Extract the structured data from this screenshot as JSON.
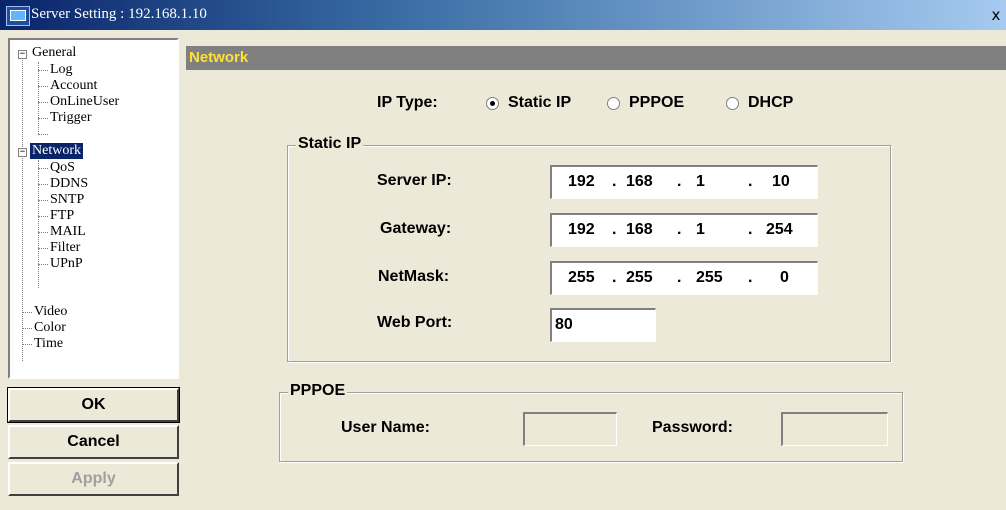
{
  "window": {
    "title": "Server Setting : 192.168.1.10",
    "close_label": "x"
  },
  "tree": {
    "general": "General",
    "log": "Log",
    "account": "Account",
    "online_user": "OnLineUser",
    "trigger": "Trigger",
    "network": "Network",
    "qos": "QoS",
    "ddns": "DDNS",
    "sntp": "SNTP",
    "ftp": "FTP",
    "mail": "MAIL",
    "filter": "Filter",
    "upnp": "UPnP",
    "video": "Video",
    "color": "Color",
    "time": "Time",
    "expander_symbol": "−"
  },
  "buttons": {
    "ok": "OK",
    "cancel": "Cancel",
    "apply": "Apply"
  },
  "panel": {
    "title": "Network"
  },
  "ip_type": {
    "label": "IP Type:",
    "options": [
      "Static IP",
      "PPPOE",
      "DHCP"
    ],
    "selected": "Static IP"
  },
  "static_ip": {
    "group_title": "Static IP",
    "server_ip": {
      "label": "Server IP:",
      "octets": [
        "192",
        "168",
        "1",
        "10"
      ]
    },
    "gateway": {
      "label": "Gateway:",
      "octets": [
        "192",
        "168",
        "1",
        "254"
      ]
    },
    "netmask": {
      "label": "NetMask:",
      "octets": [
        "255",
        "255",
        "255",
        "0"
      ]
    },
    "web_port": {
      "label": "Web Port:",
      "value": "80"
    },
    "dot": "."
  },
  "pppoe": {
    "group_title": "PPPOE",
    "user_name_label": "User Name:",
    "password_label": "Password:",
    "user_name_value": "",
    "password_value": ""
  }
}
